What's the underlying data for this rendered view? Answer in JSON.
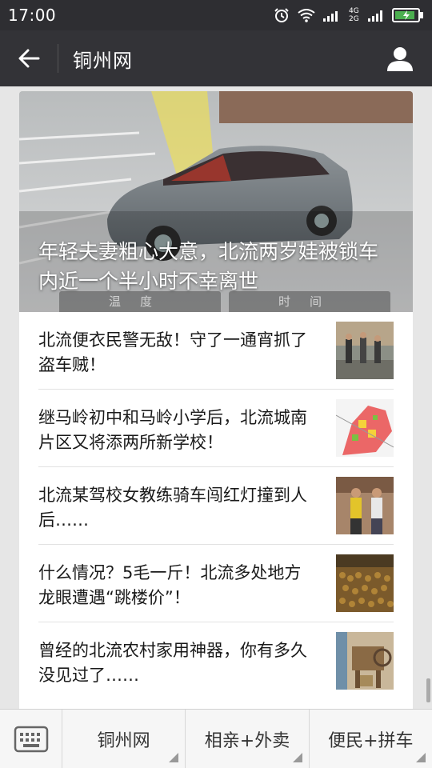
{
  "status": {
    "time": "17:00",
    "network_label": "4G 2G"
  },
  "header": {
    "title": "铜州网"
  },
  "hero": {
    "title": "年轻夫妻粗心大意，北流两岁娃被锁车内近一个半小时不幸离世",
    "strip_left": "温度",
    "strip_right": "时间"
  },
  "news": [
    {
      "title": "北流便衣民警无敌！守了一通宵抓了盗车贼！",
      "thumb_icon": "police-photo"
    },
    {
      "title": "继马岭初中和马岭小学后，北流城南片区又将添两所新学校！",
      "thumb_icon": "map-photo"
    },
    {
      "title": "北流某驾校女教练骑车闯红灯撞到人后……",
      "thumb_icon": "people-photo"
    },
    {
      "title": "什么情况？5毛一斤！北流多处地方龙眼遭遇“跳楼价”！",
      "thumb_icon": "longan-photo"
    },
    {
      "title": "曾经的北流农村家用神器，你有多久没见过了……",
      "thumb_icon": "winnower-photo"
    }
  ],
  "bottom_menu": {
    "items": [
      {
        "label": "铜州网"
      },
      {
        "label": "相亲+外卖"
      },
      {
        "label": "便民+拼车"
      }
    ]
  },
  "colors": {
    "status_bg": "#2e2e32",
    "title_bg": "#333337",
    "battery": "#4caf50"
  }
}
